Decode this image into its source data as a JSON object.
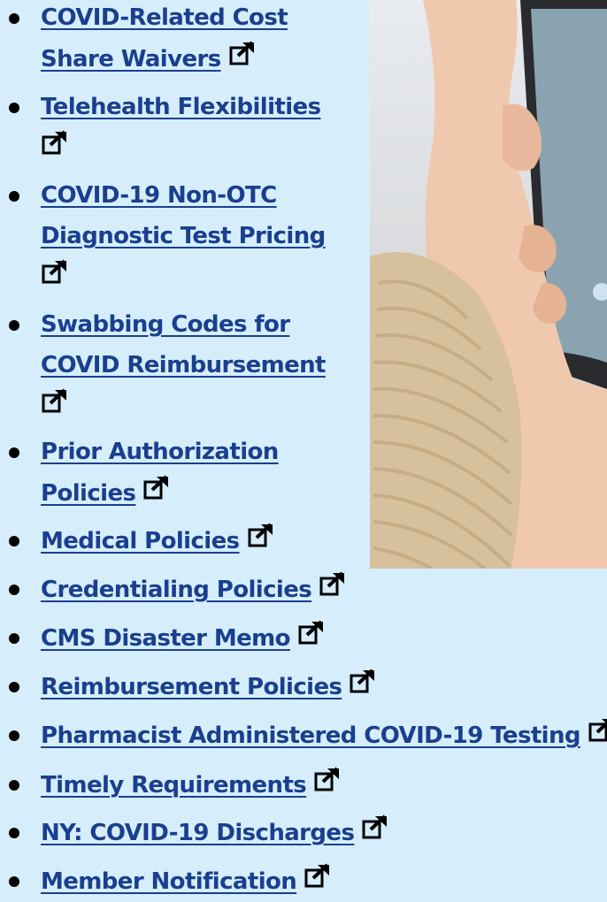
{
  "links": [
    {
      "label": "COVID-Related Cost Share Waivers",
      "line1": "COVID-Related Cost",
      "line2": "Share Waivers"
    },
    {
      "label": "Telehealth Flexibilities"
    },
    {
      "label": "COVID-19 Non-OTC Diagnostic Test Pricing",
      "line1": "COVID-19 Non-OTC",
      "line2": "Diagnostic Test Pricing"
    },
    {
      "label": "Swabbing Codes for COVID Reimbursement",
      "line1": "Swabbing Codes for",
      "line2": "COVID Reimbursement"
    },
    {
      "label": "Prior Authorization Policies",
      "line1": "Prior Authorization",
      "line2": "Policies"
    },
    {
      "label": "Medical Policies"
    },
    {
      "label": "Credentialing Policies"
    },
    {
      "label": "CMS Disaster Memo"
    },
    {
      "label": "Reimbursement Policies"
    },
    {
      "label": "Pharmacist Administered COVID-19 Testing"
    },
    {
      "label": "Timely Requirements"
    },
    {
      "label": "NY: COVID-19 Discharges"
    },
    {
      "label": "Member Notification"
    }
  ],
  "colors": {
    "background": "#d6eefb",
    "link": "#1a3f8f",
    "bullet": "#000000"
  },
  "icons": {
    "external_link": "external-link-icon"
  }
}
